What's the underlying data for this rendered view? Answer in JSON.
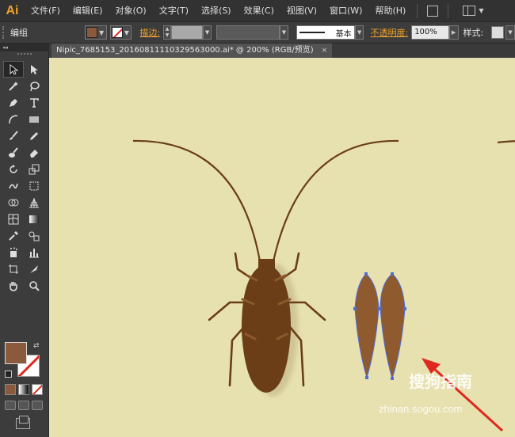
{
  "app": {
    "logo": "Ai"
  },
  "menu": {
    "items": [
      "文件(F)",
      "编辑(E)",
      "对象(O)",
      "文字(T)",
      "选择(S)",
      "效果(C)",
      "视图(V)",
      "窗口(W)",
      "帮助(H)"
    ]
  },
  "control_bar": {
    "selection_label": "编组",
    "stroke_label": "描边:",
    "stroke_style": "基本",
    "opacity_label": "不透明度:",
    "opacity_value": "100%",
    "style_label": "样式:"
  },
  "document": {
    "tab_title": "Nipic_7685153_20160811110329563000.ai*  @  200%  (RGB/预览)",
    "close_glyph": "×"
  },
  "tools": {
    "panel_header": "◂◂"
  },
  "colors": {
    "fill": "#8b5a3c",
    "canvas_bg": "#e7e1b0",
    "insect_body": "#6b3e17",
    "wing_fill": "#8f5a2e",
    "selection": "#4f6bd8",
    "arrow": "#e0281e"
  },
  "watermark": {
    "text": "搜狗指南",
    "url": "zhinan.sogou.com"
  }
}
